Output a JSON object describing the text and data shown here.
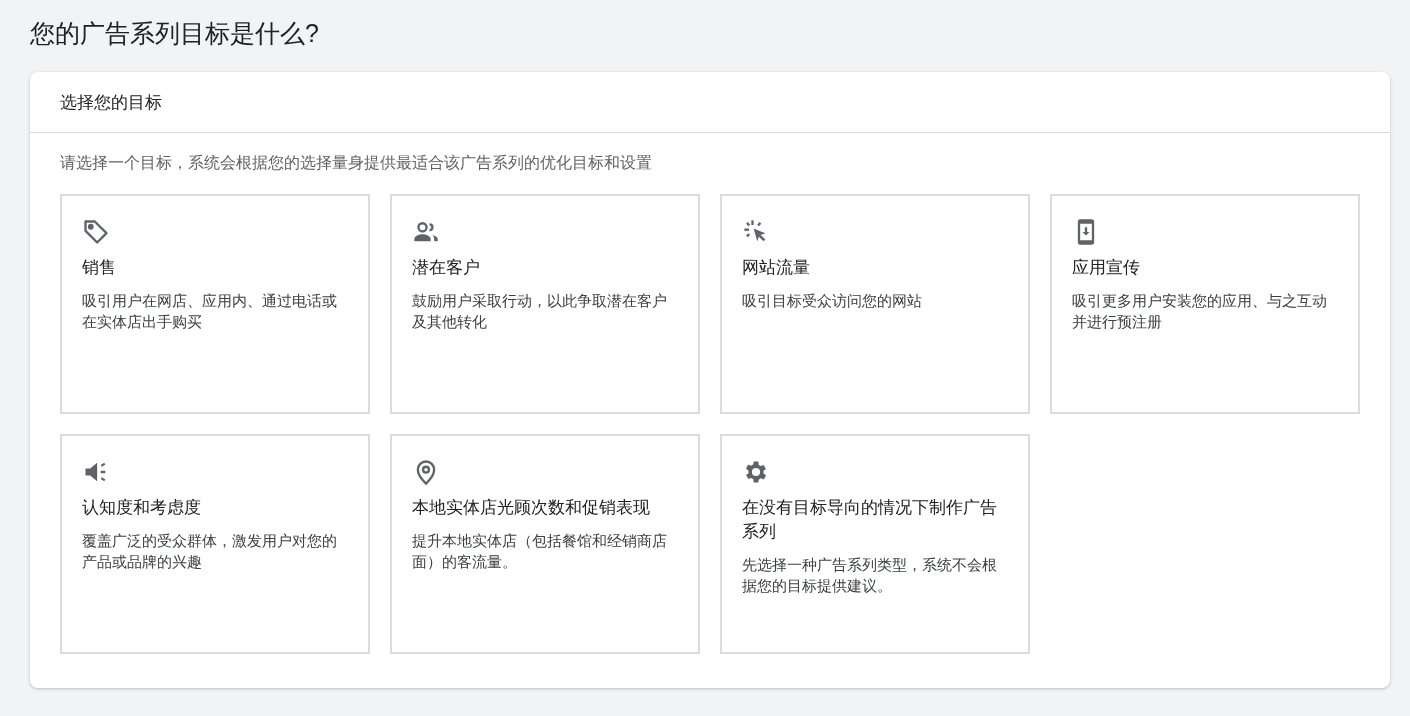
{
  "page_title": "您的广告系列目标是什么?",
  "panel": {
    "title": "选择您的目标",
    "description": "请选择一个目标，系统会根据您的选择量身提供最适合该广告系列的优化目标和设置",
    "goals": [
      {
        "kind": "tag",
        "title": "销售",
        "text": "吸引用户在网店、应用内、通过电话或在实体店出手购买"
      },
      {
        "kind": "people",
        "title": "潜在客户",
        "text": "鼓励用户采取行动，以此争取潜在客户及其他转化"
      },
      {
        "kind": "click",
        "title": "网站流量",
        "text": "吸引目标受众访问您的网站"
      },
      {
        "kind": "phone",
        "title": "应用宣传",
        "text": "吸引更多用户安装您的应用、与之互动并进行预注册"
      },
      {
        "kind": "speaker",
        "title": "认知度和考虑度",
        "text": "覆盖广泛的受众群体，激发用户对您的产品或品牌的兴趣"
      },
      {
        "kind": "pin",
        "title": "本地实体店光顾次数和促销表现",
        "text": "提升本地实体店（包括餐馆和经销商店面）的客流量。"
      },
      {
        "kind": "gear",
        "title": "在没有目标导向的情况下制作广告系列",
        "text": "先选择一种广告系列类型，系统不会根据您的目标提供建议。"
      }
    ]
  }
}
